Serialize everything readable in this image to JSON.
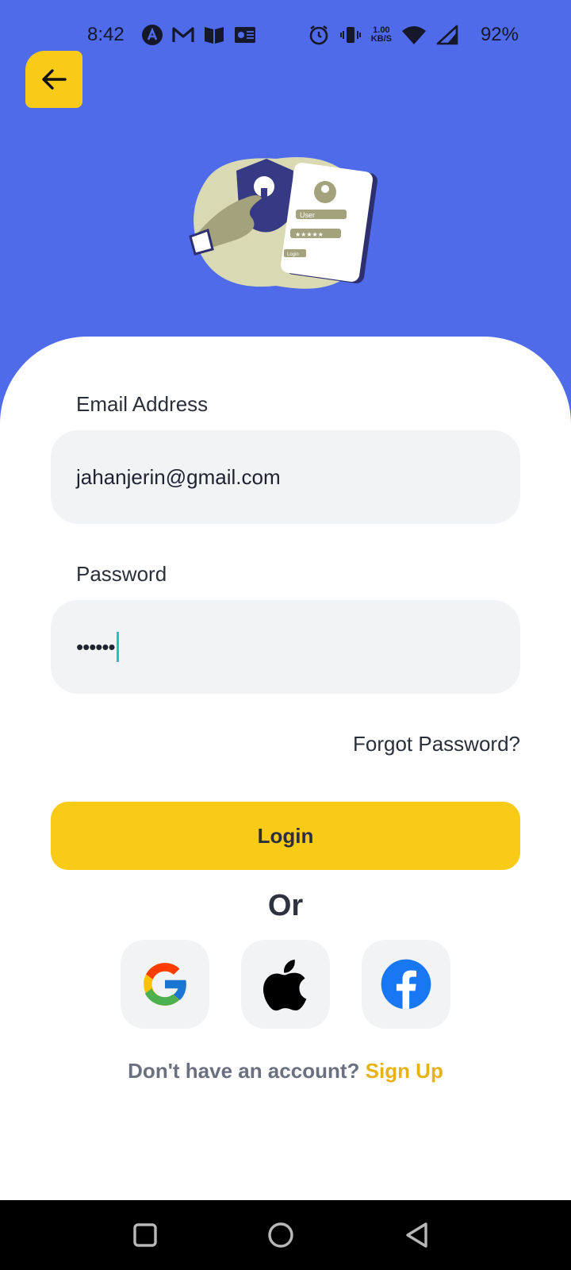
{
  "status_bar": {
    "time": "8:42",
    "netspeed_value": "1.00",
    "netspeed_unit": "KB/S",
    "battery": "92%"
  },
  "back_button": {
    "icon": "arrow-left-icon"
  },
  "illustration": {
    "user_label": "User",
    "password_mask": "★★★★★",
    "login_label": "Login"
  },
  "form": {
    "email_label": "Email Address",
    "email_value": "jahanjerin@gmail.com",
    "password_label": "Password",
    "password_value": "••••••",
    "forgot_label": "Forgot Password?",
    "login_label": "Login",
    "or_label": "Or"
  },
  "social": {
    "google": "google-logo-icon",
    "apple": "apple-logo-icon",
    "facebook": "facebook-logo-icon"
  },
  "signup": {
    "prompt": "Don't have an account?",
    "link": "Sign Up"
  },
  "colors": {
    "header_bg": "#4f6bea",
    "accent": "#f9cb17",
    "field_bg": "#f2f3f5",
    "caret": "#22c1c3",
    "signup_link": "#e6b214"
  }
}
